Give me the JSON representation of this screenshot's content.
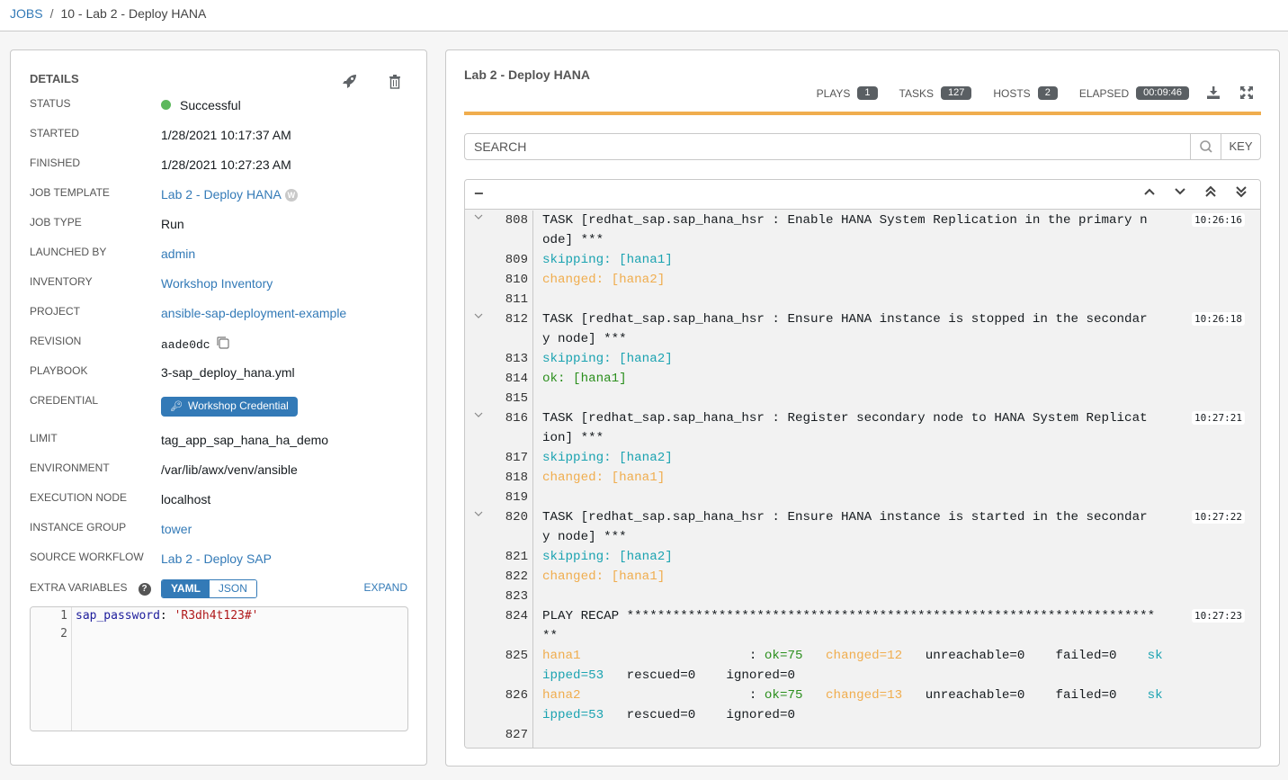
{
  "breadcrumb": {
    "root": "JOBS",
    "separator": "/",
    "current": "10 - Lab 2 - Deploy HANA"
  },
  "details": {
    "title": "DETAILS",
    "actions": {
      "relaunch_icon": "rocket-icon",
      "delete_icon": "trash-icon"
    },
    "status": {
      "label": "STATUS",
      "value": "Successful",
      "color": "#5cb85c"
    },
    "started": {
      "label": "STARTED",
      "value": "1/28/2021 10:17:37 AM"
    },
    "finished": {
      "label": "FINISHED",
      "value": "1/28/2021 10:27:23 AM"
    },
    "job_template": {
      "label": "JOB TEMPLATE",
      "value": "Lab 2 - Deploy HANA",
      "badge": "W"
    },
    "job_type": {
      "label": "JOB TYPE",
      "value": "Run"
    },
    "launched_by": {
      "label": "LAUNCHED BY",
      "value": "admin"
    },
    "inventory": {
      "label": "INVENTORY",
      "value": "Workshop Inventory"
    },
    "project": {
      "label": "PROJECT",
      "value": "ansible-sap-deployment-example"
    },
    "revision": {
      "label": "REVISION",
      "value": "aade0dc"
    },
    "playbook": {
      "label": "PLAYBOOK",
      "value": "3-sap_deploy_hana.yml"
    },
    "credential": {
      "label": "CREDENTIAL",
      "value": "Workshop Credential"
    },
    "limit": {
      "label": "LIMIT",
      "value": "tag_app_sap_hana_ha_demo"
    },
    "environment": {
      "label": "ENVIRONMENT",
      "value": "/var/lib/awx/venv/ansible"
    },
    "execution_node": {
      "label": "EXECUTION NODE",
      "value": "localhost"
    },
    "instance_group": {
      "label": "INSTANCE GROUP",
      "value": "tower"
    },
    "source_workflow": {
      "label": "SOURCE WORKFLOW",
      "value": "Lab 2 - Deploy SAP"
    },
    "extra_variables": {
      "label": "EXTRA VARIABLES",
      "formats": [
        "YAML",
        "JSON"
      ],
      "selected_format": "YAML",
      "expand_label": "EXPAND",
      "lines": [
        {
          "num": "1",
          "key": "sap_password",
          "colon": ": ",
          "value": "'R3dh4t123#'"
        },
        {
          "num": "2",
          "key": "",
          "colon": "",
          "value": ""
        }
      ]
    }
  },
  "output": {
    "title": "Lab 2 - Deploy HANA",
    "counts": [
      {
        "label": "PLAYS",
        "value": "1"
      },
      {
        "label": "TASKS",
        "value": "127"
      },
      {
        "label": "HOSTS",
        "value": "2"
      },
      {
        "label": "ELAPSED",
        "value": "00:09:46"
      }
    ],
    "progress_percent": 100,
    "progress_color": "#f0ad4e",
    "search_placeholder": "SEARCH",
    "key_label": "KEY",
    "collapse_label": "−",
    "log_lines": [
      {
        "num": "808",
        "chevron": true,
        "segments": [
          {
            "text": "TASK [redhat_sap.sap_hana_hsr : Enable HANA System Replication in the primary n",
            "cls": ""
          }
        ],
        "ts": "10:26:16"
      },
      {
        "num": "",
        "segments": [
          {
            "text": "ode] ***",
            "cls": ""
          }
        ]
      },
      {
        "num": "809",
        "segments": [
          {
            "text": "skipping: [hana1]",
            "cls": "c-skip"
          }
        ]
      },
      {
        "num": "810",
        "segments": [
          {
            "text": "changed: [hana2]",
            "cls": "c-changed"
          }
        ]
      },
      {
        "num": "811",
        "segments": []
      },
      {
        "num": "812",
        "chevron": true,
        "segments": [
          {
            "text": "TASK [redhat_sap.sap_hana_hsr : Ensure HANA instance is stopped in the secondar",
            "cls": ""
          }
        ],
        "ts": "10:26:18"
      },
      {
        "num": "",
        "segments": [
          {
            "text": "y node] ***",
            "cls": ""
          }
        ]
      },
      {
        "num": "813",
        "segments": [
          {
            "text": "skipping: [hana2]",
            "cls": "c-skip"
          }
        ]
      },
      {
        "num": "814",
        "segments": [
          {
            "text": "ok: [hana1]",
            "cls": "c-ok"
          }
        ]
      },
      {
        "num": "815",
        "segments": []
      },
      {
        "num": "816",
        "chevron": true,
        "segments": [
          {
            "text": "TASK [redhat_sap.sap_hana_hsr : Register secondary node to HANA System Replicat",
            "cls": ""
          }
        ],
        "ts": "10:27:21"
      },
      {
        "num": "",
        "segments": [
          {
            "text": "ion] ***",
            "cls": ""
          }
        ]
      },
      {
        "num": "817",
        "segments": [
          {
            "text": "skipping: [hana2]",
            "cls": "c-skip"
          }
        ]
      },
      {
        "num": "818",
        "segments": [
          {
            "text": "changed: [hana1]",
            "cls": "c-changed"
          }
        ]
      },
      {
        "num": "819",
        "segments": []
      },
      {
        "num": "820",
        "chevron": true,
        "segments": [
          {
            "text": "TASK [redhat_sap.sap_hana_hsr : Ensure HANA instance is started in the secondar",
            "cls": ""
          }
        ],
        "ts": "10:27:22"
      },
      {
        "num": "",
        "segments": [
          {
            "text": "y node] ***",
            "cls": ""
          }
        ]
      },
      {
        "num": "821",
        "segments": [
          {
            "text": "skipping: [hana2]",
            "cls": "c-skip"
          }
        ]
      },
      {
        "num": "822",
        "segments": [
          {
            "text": "changed: [hana1]",
            "cls": "c-changed"
          }
        ]
      },
      {
        "num": "823",
        "segments": []
      },
      {
        "num": "824",
        "segments": [
          {
            "text": "PLAY RECAP *********************************************************************",
            "cls": ""
          }
        ],
        "ts": "10:27:23"
      },
      {
        "num": "",
        "segments": [
          {
            "text": "**",
            "cls": ""
          }
        ]
      },
      {
        "num": "825",
        "segments": [
          {
            "text": "hana1",
            "cls": "c-changed"
          },
          {
            "text": "                      : ",
            "cls": ""
          },
          {
            "text": "ok=75",
            "cls": "c-ok"
          },
          {
            "text": "   ",
            "cls": ""
          },
          {
            "text": "changed=12",
            "cls": "c-changed"
          },
          {
            "text": "   unreachable=0    failed=0    ",
            "cls": ""
          },
          {
            "text": "sk",
            "cls": "c-skip"
          }
        ]
      },
      {
        "num": "",
        "segments": [
          {
            "text": "ipped=53",
            "cls": "c-skip"
          },
          {
            "text": "   rescued=0    ignored=0",
            "cls": ""
          }
        ]
      },
      {
        "num": "826",
        "segments": [
          {
            "text": "hana2",
            "cls": "c-changed"
          },
          {
            "text": "                      : ",
            "cls": ""
          },
          {
            "text": "ok=75",
            "cls": "c-ok"
          },
          {
            "text": "   ",
            "cls": ""
          },
          {
            "text": "changed=13",
            "cls": "c-changed"
          },
          {
            "text": "   unreachable=0    failed=0    ",
            "cls": ""
          },
          {
            "text": "sk",
            "cls": "c-skip"
          }
        ]
      },
      {
        "num": "",
        "segments": [
          {
            "text": "ipped=53",
            "cls": "c-skip"
          },
          {
            "text": "   rescued=0    ignored=0",
            "cls": ""
          }
        ]
      },
      {
        "num": "827",
        "segments": []
      }
    ]
  }
}
